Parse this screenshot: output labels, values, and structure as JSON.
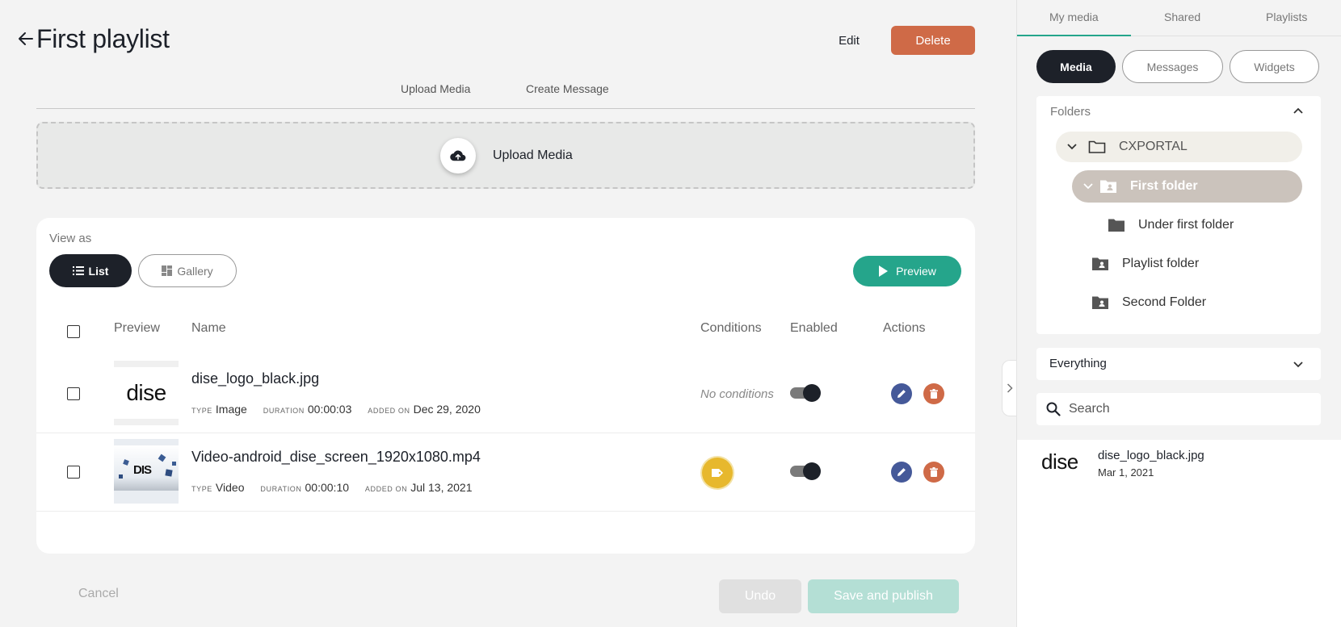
{
  "header": {
    "title": "First playlist",
    "edit_label": "Edit",
    "delete_label": "Delete"
  },
  "subtabs": [
    "Upload Media",
    "Create Message"
  ],
  "upload_zone": {
    "label": "Upload Media"
  },
  "card": {
    "view_as": "View as",
    "list_label": "List",
    "gallery_label": "Gallery",
    "preview_label": "Preview",
    "columns": {
      "preview": "Preview",
      "name": "Name",
      "conditions": "Conditions",
      "enabled": "Enabled",
      "actions": "Actions"
    },
    "rows": [
      {
        "name": "dise_logo_black.jpg",
        "type_key": "TYPE",
        "type": "Image",
        "duration_key": "DURATION",
        "duration": "00:00:03",
        "added_key": "ADDED ON",
        "added": "Dec 29, 2020",
        "conditions": "No conditions",
        "thumb_text": "dise",
        "enabled": true
      },
      {
        "name": "Video-android_dise_screen_1920x1080.mp4",
        "type_key": "TYPE",
        "type": "Video",
        "duration_key": "DURATION",
        "duration": "00:00:10",
        "added_key": "ADDED ON",
        "added": "Jul 13, 2021",
        "conditions": "tag-icon",
        "thumb_text": "DIS",
        "enabled": true
      }
    ]
  },
  "footer": {
    "cancel_label": "Cancel",
    "undo_label": "Undo",
    "save_label": "Save and publish"
  },
  "sidebar": {
    "tabs": [
      "My media",
      "Shared",
      "Playlists"
    ],
    "pills": [
      "Media",
      "Messages",
      "Widgets"
    ],
    "folders_title": "Folders",
    "folders": [
      {
        "label": "CXPORTAL"
      },
      {
        "label": "First folder"
      },
      {
        "label": "Under first folder"
      },
      {
        "label": "Playlist folder"
      },
      {
        "label": "Second Folder"
      }
    ],
    "filter_label": "Everything",
    "search_placeholder": "Search",
    "media_items": [
      {
        "thumb_text": "dise",
        "name": "dise_logo_black.jpg",
        "date": "Mar 1, 2021"
      }
    ]
  },
  "colors": {
    "accent_green": "#25a58b",
    "delete_orange": "#cf6a47",
    "edit_blue": "#455999",
    "condition_yellow": "#e7b82d",
    "dark": "#1d2129"
  }
}
